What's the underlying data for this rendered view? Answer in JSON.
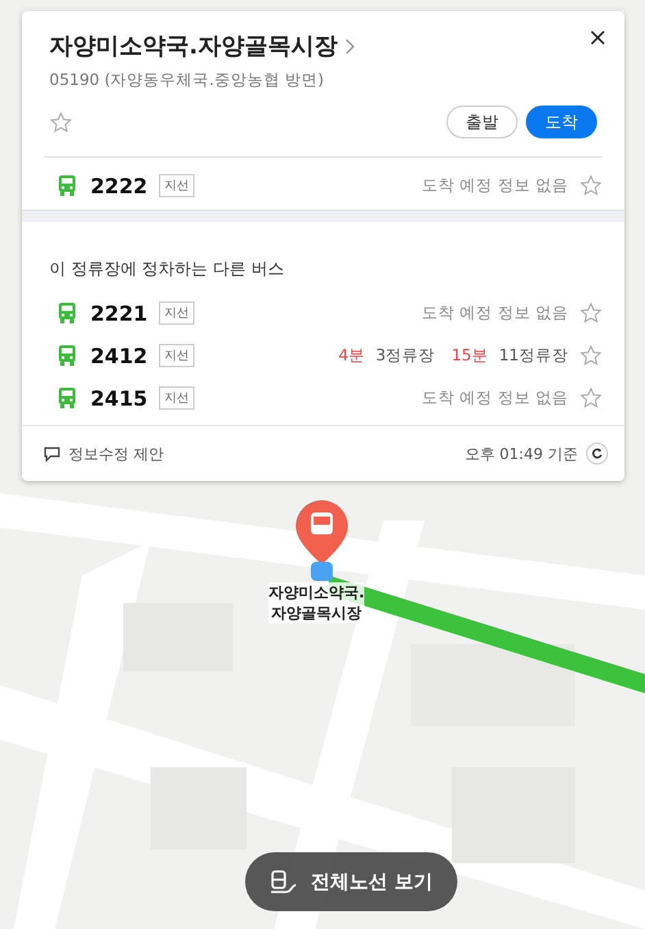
{
  "stop": {
    "name": "자양미소약국.자양골목시장",
    "subtitle": "05190 (자양동우체국.중앙농협 방면)"
  },
  "direction_buttons": [
    {
      "label": "출발",
      "selected": false
    },
    {
      "label": "도착",
      "selected": true
    }
  ],
  "favorite_route": {
    "number": "2222",
    "type": "지선",
    "status": "도착 예정 정보 없음"
  },
  "other_buses": {
    "heading": "이 정류장에 정차하는 다른 버스",
    "routes": [
      {
        "number": "2221",
        "type": "지선",
        "status": "도착 예정 정보 없음"
      },
      {
        "number": "2412",
        "type": "지선",
        "arrivals": [
          {
            "time": "4분",
            "stops": "3정류장"
          },
          {
            "time": "15분",
            "stops": "11정류장"
          }
        ]
      },
      {
        "number": "2415",
        "type": "지선",
        "status": "도착 예정 정보 없음"
      }
    ]
  },
  "footer": {
    "suggest": "정보수정 제안",
    "updated": "오후 01:49 기준"
  },
  "map": {
    "kind": "picture",
    "marker_label": "자양미소약국.\n자양골목시장"
  },
  "all_routes_button": "전체노선 보기"
}
